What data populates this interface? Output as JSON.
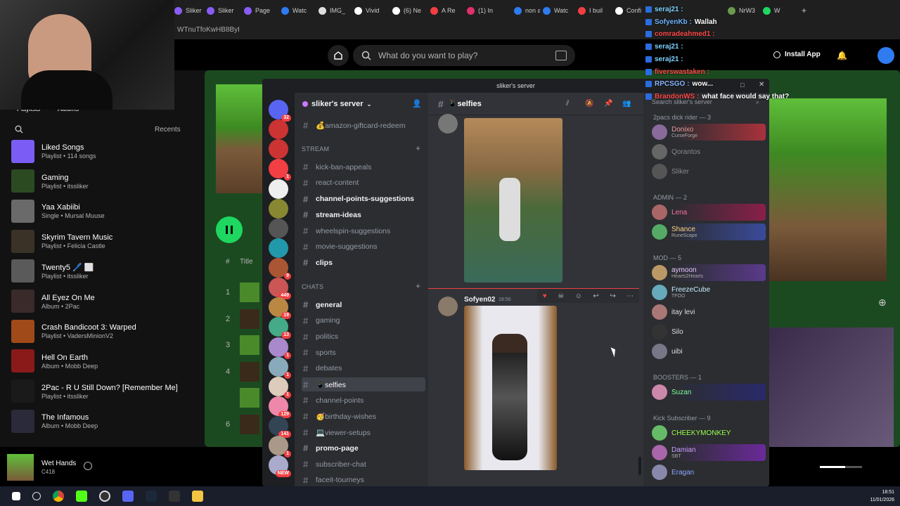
{
  "browser": {
    "tabs": [
      "Sliker",
      "Sliker",
      "Page",
      "Watc",
      "IMG_",
      "Vivid",
      "(6) Ne",
      "A Re",
      "(1) In",
      "non a",
      "Watc",
      "I buil",
      "Confi",
      "seraj21 :",
      "NrW3",
      "W"
    ],
    "address": "WTnuTfoKwHB8ByI"
  },
  "spotify": {
    "search_placeholder": "What do you want to play?",
    "install_label": "Install App",
    "library_tabs": [
      "Playlists",
      "Albums"
    ],
    "recents_label": "Recents",
    "library": [
      {
        "title": "Liked Songs",
        "sub": "Playlist • 114 songs",
        "color": "#7b5cf5"
      },
      {
        "title": "Gaming",
        "sub": "Playlist • itssliker",
        "color": "#2c4a22"
      },
      {
        "title": "Yaa Xabiibi",
        "sub": "Single • Mursal Muuse",
        "color": "#6a6a6a"
      },
      {
        "title": "Skyrim Tavern Music",
        "sub": "Playlist • Felicia Castle",
        "color": "#3a3226"
      },
      {
        "title": "Twenty5 🖊️ ⬜",
        "sub": "Playlist • itssliker",
        "color": "#5a5a5a"
      },
      {
        "title": "All Eyez On Me",
        "sub": "Album • 2Pac",
        "color": "#3a2a2a"
      },
      {
        "title": "Crash Bandicoot 3: Warped",
        "sub": "Playlist • VadersMinionV2",
        "color": "#a04a1a"
      },
      {
        "title": "Hell On Earth",
        "sub": "Album • Mobb Deep",
        "color": "#8a1a1a"
      },
      {
        "title": "2Pac - R U Still Down? [Remember Me]",
        "sub": "Playlist • itssliker",
        "color": "#1a1a1a"
      },
      {
        "title": "The Infamous",
        "sub": "Album • Mobb Deep",
        "color": "#2a2a3a"
      }
    ],
    "track_header": "Title",
    "track_numbers": [
      "1",
      "2",
      "3",
      "4",
      "",
      "6"
    ],
    "now_playing": {
      "title": "Wet Hands",
      "artist": "C418"
    }
  },
  "discord": {
    "window_title": "sliker's server",
    "server_name": "sliker's server",
    "guild_badges": [
      "32",
      "",
      "",
      "1",
      "",
      "",
      "",
      "",
      "9",
      "449",
      "19",
      "13",
      "1",
      "1",
      "1",
      "129",
      "141",
      "1",
      "NEW"
    ],
    "channels": [
      {
        "name": "💰amazon-giftcard-redeem",
        "state": "normal"
      },
      {
        "cat": "STREAM"
      },
      {
        "name": "kick-ban-appeals",
        "state": "normal"
      },
      {
        "name": "react-content",
        "state": "normal"
      },
      {
        "name": "channel-points-suggestions",
        "state": "unread"
      },
      {
        "name": "stream-ideas",
        "state": "unread"
      },
      {
        "name": "wheelspin-suggestions",
        "state": "normal"
      },
      {
        "name": "movie-suggestions",
        "state": "normal"
      },
      {
        "name": "clips",
        "state": "unread"
      },
      {
        "cat": "CHATS"
      },
      {
        "name": "general",
        "state": "unread"
      },
      {
        "name": "gaming",
        "state": "normal"
      },
      {
        "name": "politics",
        "state": "normal"
      },
      {
        "name": "sports",
        "state": "normal"
      },
      {
        "name": "debates",
        "state": "normal"
      },
      {
        "name": "📱selfies",
        "state": "active"
      },
      {
        "name": "channel-points",
        "state": "normal"
      },
      {
        "name": "🥳birthday-wishes",
        "state": "normal"
      },
      {
        "name": "💻viewer-setups",
        "state": "normal"
      },
      {
        "name": "promo-page",
        "state": "unread"
      },
      {
        "name": "subscriber-chat",
        "state": "normal"
      },
      {
        "name": "faceit-tourneys",
        "state": "normal"
      }
    ],
    "chat_channel": "📱selfies",
    "message": {
      "author": "Sofyen02",
      "time": "18:50"
    },
    "members_search": "Search sliker's server",
    "groups": [
      {
        "label": "2pacs dick rider — 3",
        "members": [
          {
            "n": "Donixo",
            "s": "CurseForge",
            "c": "#e89a9a",
            "bg": "#a8323c"
          },
          {
            "n": "Qorantos",
            "s": "",
            "c": "#888",
            "bg": ""
          },
          {
            "n": "Sliker",
            "s": "",
            "c": "#888",
            "bg": ""
          }
        ]
      },
      {
        "label": "ADMIN — 2",
        "members": [
          {
            "n": "Lena",
            "s": "",
            "c": "#ff6fa0",
            "bg": "#8a1f4a"
          },
          {
            "n": "Shance",
            "s": "RuneScape",
            "c": "#ffd28a",
            "bg": "#3a4a9a"
          }
        ]
      },
      {
        "label": "MOD — 5",
        "members": [
          {
            "n": "aymoon",
            "s": "Hearts2Hearts",
            "c": "#e8c8ff",
            "bg": "#5a3a8a"
          },
          {
            "n": "FreezeCube",
            "s": "TFOO",
            "c": "#c8f0ff",
            "bg": ""
          },
          {
            "n": "itay levi",
            "s": "",
            "c": "#ddd",
            "bg": ""
          },
          {
            "n": "Silo",
            "s": "",
            "c": "#ddd",
            "bg": ""
          },
          {
            "n": "uibi",
            "s": "",
            "c": "#ddd",
            "bg": ""
          }
        ]
      },
      {
        "label": "BOOSTERS — 1",
        "members": [
          {
            "n": "Suzan",
            "s": "",
            "c": "#7dff9a",
            "bg": "#2a2a6a"
          }
        ]
      },
      {
        "label": "Kick Subscriber — 9",
        "members": [
          {
            "n": "CHEEKYMONKEY",
            "s": "",
            "c": "#9bff4a",
            "bg": ""
          },
          {
            "n": "Damian",
            "s": "SBT",
            "c": "#c8a0ff",
            "bg": "#6a2a9a"
          },
          {
            "n": "Eragan",
            "s": "",
            "c": "#8aa8ff",
            "bg": ""
          }
        ]
      }
    ]
  },
  "twitch_chat": [
    {
      "user": "seraj21 :",
      "text": "",
      "c": "#7dd3ff"
    },
    {
      "user": "SofyenKb :",
      "text": "Wallah",
      "c": "#6fb2ff"
    },
    {
      "user": "comradeahmed1 :",
      "text": "",
      "c": "#ff4a4a"
    },
    {
      "user": "seraj21 :",
      "text": "",
      "c": "#7dd3ff"
    },
    {
      "user": "seraj21 :",
      "text": "",
      "c": "#7dd3ff"
    },
    {
      "user": "fiverswastaken :",
      "text": "",
      "c": "#ff4a4a"
    },
    {
      "user": "RPCSGO :",
      "text": "wow...",
      "c": "#8ab4ff"
    },
    {
      "user": "BrandonWS :",
      "text": "what face would say that?",
      "c": "#ff4a4a"
    }
  ],
  "clock": {
    "time": "18:51",
    "date": "11/01/2026"
  }
}
